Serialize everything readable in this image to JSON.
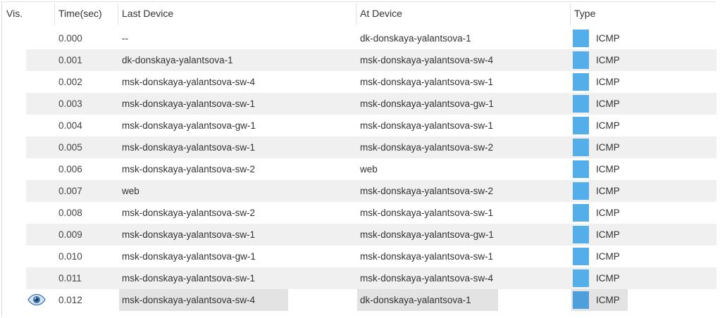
{
  "columns": {
    "vis": "Vis.",
    "time": "Time(sec)",
    "last_device": "Last Device",
    "at_device": "At Device",
    "type": "Type"
  },
  "type_color": "#54aee9",
  "selected_row_index": 12,
  "rows": [
    {
      "time": "0.000",
      "last": "--",
      "at": "dk-donskaya-yalantsova-1",
      "type": "ICMP"
    },
    {
      "time": "0.001",
      "last": "dk-donskaya-yalantsova-1",
      "at": "msk-donskaya-yalantsova-sw-4",
      "type": "ICMP"
    },
    {
      "time": "0.002",
      "last": "msk-donskaya-yalantsova-sw-4",
      "at": "msk-donskaya-yalantsova-sw-1",
      "type": "ICMP"
    },
    {
      "time": "0.003",
      "last": "msk-donskaya-yalantsova-sw-1",
      "at": "msk-donskaya-yalantsova-gw-1",
      "type": "ICMP"
    },
    {
      "time": "0.004",
      "last": "msk-donskaya-yalantsova-gw-1",
      "at": "msk-donskaya-yalantsova-sw-1",
      "type": "ICMP"
    },
    {
      "time": "0.005",
      "last": "msk-donskaya-yalantsova-sw-1",
      "at": "msk-donskaya-yalantsova-sw-2",
      "type": "ICMP"
    },
    {
      "time": "0.006",
      "last": "msk-donskaya-yalantsova-sw-2",
      "at": "web",
      "type": "ICMP"
    },
    {
      "time": "0.007",
      "last": "web",
      "at": "msk-donskaya-yalantsova-sw-2",
      "type": "ICMP"
    },
    {
      "time": "0.008",
      "last": "msk-donskaya-yalantsova-sw-2",
      "at": "msk-donskaya-yalantsova-sw-1",
      "type": "ICMP"
    },
    {
      "time": "0.009",
      "last": "msk-donskaya-yalantsova-sw-1",
      "at": "msk-donskaya-yalantsova-gw-1",
      "type": "ICMP"
    },
    {
      "time": "0.010",
      "last": "msk-donskaya-yalantsova-gw-1",
      "at": "msk-donskaya-yalantsova-sw-1",
      "type": "ICMP"
    },
    {
      "time": "0.011",
      "last": "msk-donskaya-yalantsova-sw-1",
      "at": "msk-donskaya-yalantsova-sw-4",
      "type": "ICMP"
    },
    {
      "time": "0.012",
      "last": "msk-donskaya-yalantsova-sw-4",
      "at": "dk-donskaya-yalantsova-1",
      "type": "ICMP"
    }
  ]
}
